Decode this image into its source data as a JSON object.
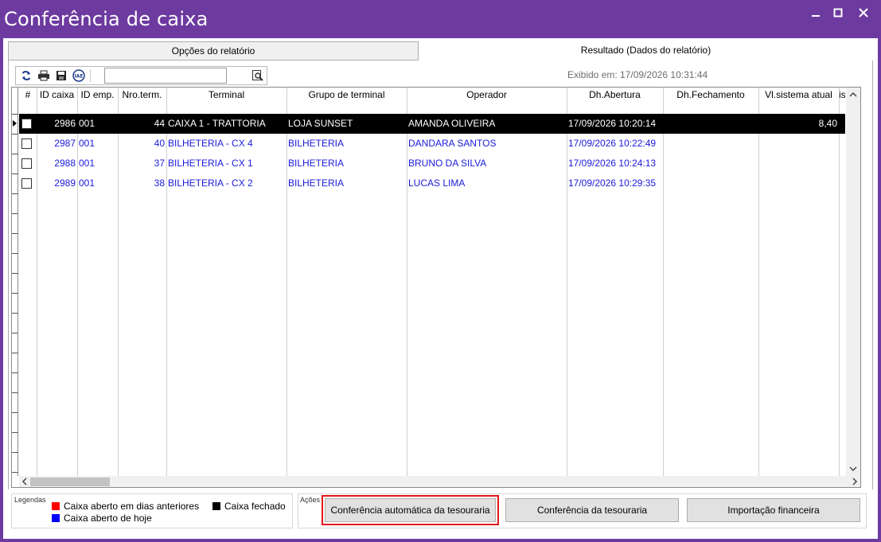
{
  "window": {
    "title": "Conferência de caixa",
    "minimize_glyph": "▁",
    "maximize_glyph": "□",
    "close_glyph": "✕"
  },
  "tabs": [
    {
      "label": "Opções do relatório",
      "active": false
    },
    {
      "label": "Resultado (Dados do relatório)",
      "active": true
    }
  ],
  "toolbar": {
    "search_value": "",
    "icons": [
      "refresh-icon",
      "print-icon",
      "save-icon",
      "iae-icon",
      "search-zoom-icon"
    ]
  },
  "exibido": "Exibido em: 17/09/2026 10:31:44",
  "grid": {
    "columns": [
      "#",
      "ID caixa",
      "ID emp.",
      "Nro.term.",
      "Terminal",
      "Grupo de terminal",
      "Operador",
      "Dh.Abertura",
      "Dh.Fechamento",
      "Vl.sistema atual",
      "iste"
    ],
    "rows": [
      {
        "id_caixa": "2986",
        "id_emp": "001",
        "nro_term": "44",
        "terminal": "CAIXA 1 - TRATTORIA",
        "grupo": "LOJA SUNSET",
        "operador": "AMANDA OLIVEIRA",
        "abertura": "17/09/2026 10:20:14",
        "fechamento": "",
        "vl_sistema": "8,40",
        "selected": true
      },
      {
        "id_caixa": "2987",
        "id_emp": "001",
        "nro_term": "40",
        "terminal": "BILHETERIA - CX 4",
        "grupo": "BILHETERIA",
        "operador": "DANDARA SANTOS",
        "abertura": "17/09/2026 10:22:49",
        "fechamento": "",
        "vl_sistema": "",
        "selected": false
      },
      {
        "id_caixa": "2988",
        "id_emp": "001",
        "nro_term": "37",
        "terminal": "BILHETERIA - CX 1",
        "grupo": "BILHETERIA",
        "operador": "BRUNO DA SILVA",
        "abertura": "17/09/2026 10:24:13",
        "fechamento": "",
        "vl_sistema": "",
        "selected": false
      },
      {
        "id_caixa": "2989",
        "id_emp": "001",
        "nro_term": "38",
        "terminal": "BILHETERIA - CX 2",
        "grupo": "BILHETERIA",
        "operador": "LUCAS LIMA",
        "abertura": "17/09/2026 10:29:35",
        "fechamento": "",
        "vl_sistema": "",
        "selected": false
      }
    ]
  },
  "legend": {
    "caption": "Legendas",
    "items": [
      {
        "label": "Caixa aberto em dias anteriores",
        "color": "#ff0000"
      },
      {
        "label": "Caixa aberto de hoje",
        "color": "#0000ff"
      },
      {
        "label": "Caixa fechado",
        "color": "#000000"
      }
    ]
  },
  "acoes": {
    "caption": "Ações",
    "buttons": [
      {
        "label": "Conferência automática da tesouraria",
        "highlighted": true
      },
      {
        "label": "Conferência da tesouraria",
        "highlighted": false
      },
      {
        "label": "Importação financeira",
        "highlighted": false
      }
    ]
  },
  "colors": {
    "window_purple": "#6d3aa0",
    "row_today": "#1a1adb",
    "highlight_red": "#e3161b"
  }
}
